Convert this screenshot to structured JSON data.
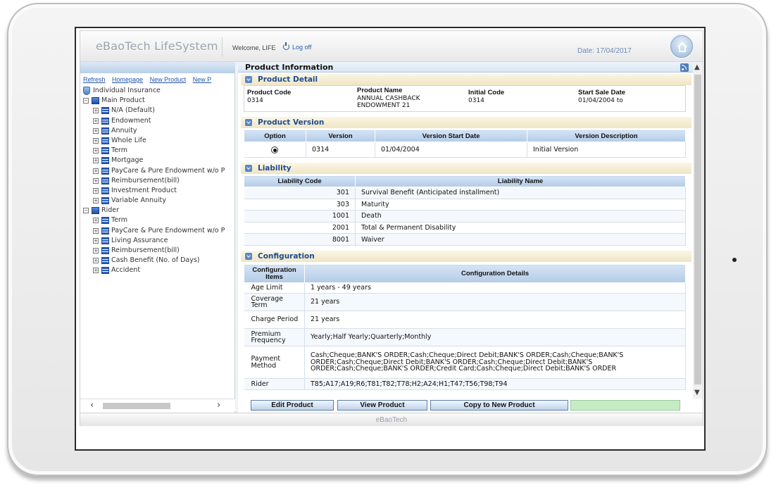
{
  "header": {
    "app_title": "eBaoTech LifeSystem",
    "welcome": "Welcome, LIFE",
    "logoff": "Log off",
    "date": "Date: 17/04/2017"
  },
  "left": {
    "links": [
      "Refresh",
      "Homepage",
      "New Product",
      "New P"
    ],
    "tree": [
      {
        "label": "Individual Insurance",
        "icon": "shield-icon",
        "level": 0,
        "toggle": ""
      },
      {
        "label": "Main Product",
        "icon": "book-icon",
        "level": 0,
        "toggle": "−"
      },
      {
        "label": "N/A (Default)",
        "icon": "list-icon",
        "level": 1,
        "toggle": "+"
      },
      {
        "label": "Endowment",
        "icon": "list-icon",
        "level": 1,
        "toggle": "+"
      },
      {
        "label": "Annuity",
        "icon": "list-icon",
        "level": 1,
        "toggle": "+"
      },
      {
        "label": "Whole Life",
        "icon": "list-icon",
        "level": 1,
        "toggle": "+"
      },
      {
        "label": "Term",
        "icon": "list-icon",
        "level": 1,
        "toggle": "+"
      },
      {
        "label": "Mortgage",
        "icon": "list-icon",
        "level": 1,
        "toggle": "+"
      },
      {
        "label": "PayCare & Pure Endowment w/o P",
        "icon": "list-icon",
        "level": 1,
        "toggle": "+"
      },
      {
        "label": "Reimbursement(bill)",
        "icon": "list-icon",
        "level": 1,
        "toggle": "+"
      },
      {
        "label": "Investment Product",
        "icon": "list-icon",
        "level": 1,
        "toggle": "+"
      },
      {
        "label": "Variable Annuity",
        "icon": "list-icon",
        "level": 1,
        "toggle": "+"
      },
      {
        "label": "Rider",
        "icon": "book-icon",
        "level": 0,
        "toggle": "−"
      },
      {
        "label": "Term",
        "icon": "list-icon",
        "level": 1,
        "toggle": "+"
      },
      {
        "label": "PayCare & Pure Endowment w/o P",
        "icon": "list-icon",
        "level": 1,
        "toggle": "+"
      },
      {
        "label": "Living Assurance",
        "icon": "list-icon",
        "level": 1,
        "toggle": "+"
      },
      {
        "label": "Reimbursement(bill)",
        "icon": "list-icon",
        "level": 1,
        "toggle": "+"
      },
      {
        "label": "Cash Benefit (No. of Days)",
        "icon": "list-icon",
        "level": 1,
        "toggle": "+"
      },
      {
        "label": "Accident",
        "icon": "list-icon",
        "level": 1,
        "toggle": "+"
      }
    ]
  },
  "main": {
    "title": "Product Information",
    "sections": {
      "detail": "Product Detail",
      "version": "Product Version",
      "liability": "Liability",
      "configuration": "Configuration"
    },
    "detail": {
      "code_label": "Product Code",
      "code": "0314",
      "name_label": "Product Name",
      "name_line1": "ANNUAL CASHBACK",
      "name_line2": "ENDOWMENT 21",
      "initial_label": "Initial Code",
      "initial": "0314",
      "start_label": "Start Sale Date",
      "start": "01/04/2004 to"
    },
    "version_table": {
      "headers": [
        "Option",
        "Version",
        "Version Start Date",
        "Version Description"
      ],
      "row": {
        "version": "0314",
        "start": "01/04/2004",
        "desc": "Initial Version"
      }
    },
    "liability_table": {
      "headers": [
        "Liability Code",
        "Liability Name"
      ],
      "rows": [
        {
          "code": "301",
          "name": "Survival Benefit (Anticipated installment)"
        },
        {
          "code": "303",
          "name": "Maturity"
        },
        {
          "code": "1001",
          "name": "Death"
        },
        {
          "code": "2001",
          "name": "Total & Permanent Disability"
        },
        {
          "code": "8001",
          "name": "Waiver"
        }
      ]
    },
    "config_table": {
      "headers": [
        "Configuration Items",
        "Configuration Details"
      ],
      "rows": [
        {
          "item": "Age Limit",
          "detail": "1 years - 49 years"
        },
        {
          "item": "Coverage Term",
          "detail": "21 years"
        },
        {
          "item": "Charge Period",
          "detail": "21 years"
        },
        {
          "item": "Premium Frequency",
          "detail": "Yearly;Half Yearly;Quarterly;Monthly"
        },
        {
          "item": "Payment Method",
          "detail": "Cash;Cheque;BANK'S ORDER;Cash;Cheque;Direct Debit;BANK'S ORDER;Cash;Cheque;BANK'S ORDER;Cash;Cheque;Direct Debit;BANK'S ORDER;Cash;Cheque;Direct Debit;BANK'S ORDER;Cash;Cheque;BANK'S ORDER;Credit Card;Cash;Cheque;Direct Debit;BANK'S ORDER"
        },
        {
          "item": "Rider",
          "detail": "T85;A17;A19;R6;T81;T82;T78;H2;A24;H1;T47;T56;T98;T94"
        }
      ]
    },
    "buttons": {
      "edit": "Edit Product",
      "view": "View Product",
      "copy": "Copy to New Product"
    }
  },
  "footer": "eBaoTech"
}
